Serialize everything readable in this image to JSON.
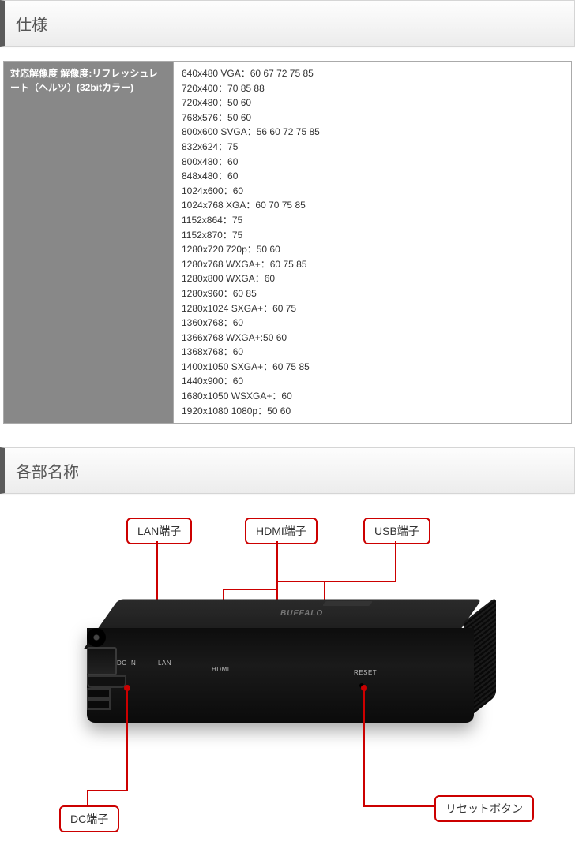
{
  "sections": {
    "spec": {
      "title": "仕様",
      "label": "対応解像度\n解像度:リフレッシュレート（ヘルツ）(32bitカラー)",
      "value": "640x480 VGA：60 67 72 75 85\n720x400：70 85 88\n720x480：50 60\n768x576：50 60\n800x600 SVGA：56 60 72 75 85\n832x624：75\n800x480：60\n848x480：60\n1024x600：60\n1024x768 XGA：60 70 75 85\n1152x864：75\n1152x870：75\n1280x720 720p：50 60\n1280x768 WXGA+：60 75 85\n1280x800 WXGA：60\n1280x960：60 85\n1280x1024 SXGA+：60 75\n1360x768：60\n1366x768 WXGA+:50 60\n1368x768：60\n1400x1050 SXGA+：60 75 85\n1440x900：60\n1680x1050 WSXGA+：60\n1920x1080 1080p：50 60"
    },
    "parts": {
      "title": "各部名称",
      "callouts": {
        "lan": "LAN端子",
        "hdmi": "HDMI端子",
        "usb": "USB端子",
        "dc": "DC端子",
        "reset": "リセットボタン"
      },
      "port_labels": {
        "dcin": "DC IN",
        "lan": "LAN",
        "hdmi": "HDMI",
        "reset": "RESET"
      },
      "brand": "BUFFALO"
    }
  }
}
